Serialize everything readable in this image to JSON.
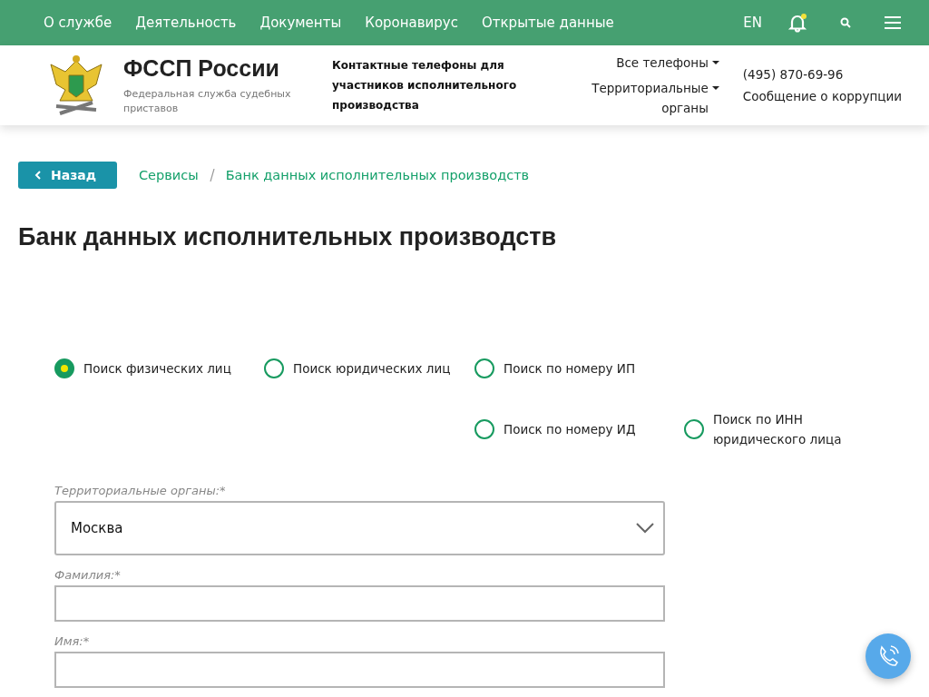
{
  "top_nav": {
    "items": [
      "О службе",
      "Деятельность",
      "Документы",
      "Коронавирус",
      "Открытые данные"
    ],
    "language": "EN",
    "notification_unread": true
  },
  "header": {
    "title": "ФССП России",
    "subtitle": "Федеральная служба судебных приставов",
    "contacts_heading": "Контактные телефоны для участников исполнительного производства",
    "dropdowns": [
      "Все телефоны",
      "Территориальные органы"
    ],
    "phone": "(495) 870-69-96",
    "corruption_link": "Сообщение о коррупции"
  },
  "back_button": "Назад",
  "breadcrumbs": [
    "Сервисы",
    "Банк данных исполнительных производств"
  ],
  "page_title": "Банк данных исполнительных производств",
  "search_types": [
    {
      "label": "Поиск физических лиц",
      "selected": true
    },
    {
      "label": "Поиск юридических лиц",
      "selected": false
    },
    {
      "label": "Поиск по номеру ИП",
      "selected": false
    },
    {
      "label": "Поиск по номеру ИД",
      "selected": false
    },
    {
      "label": "Поиск по ИНН юридического лица",
      "selected": false
    }
  ],
  "form": [
    {
      "kind": "select",
      "label": "Территориальные органы:*",
      "value": "Москва"
    },
    {
      "kind": "text",
      "label": "Фамилия:*"
    },
    {
      "kind": "text",
      "label": "Имя:*"
    }
  ]
}
